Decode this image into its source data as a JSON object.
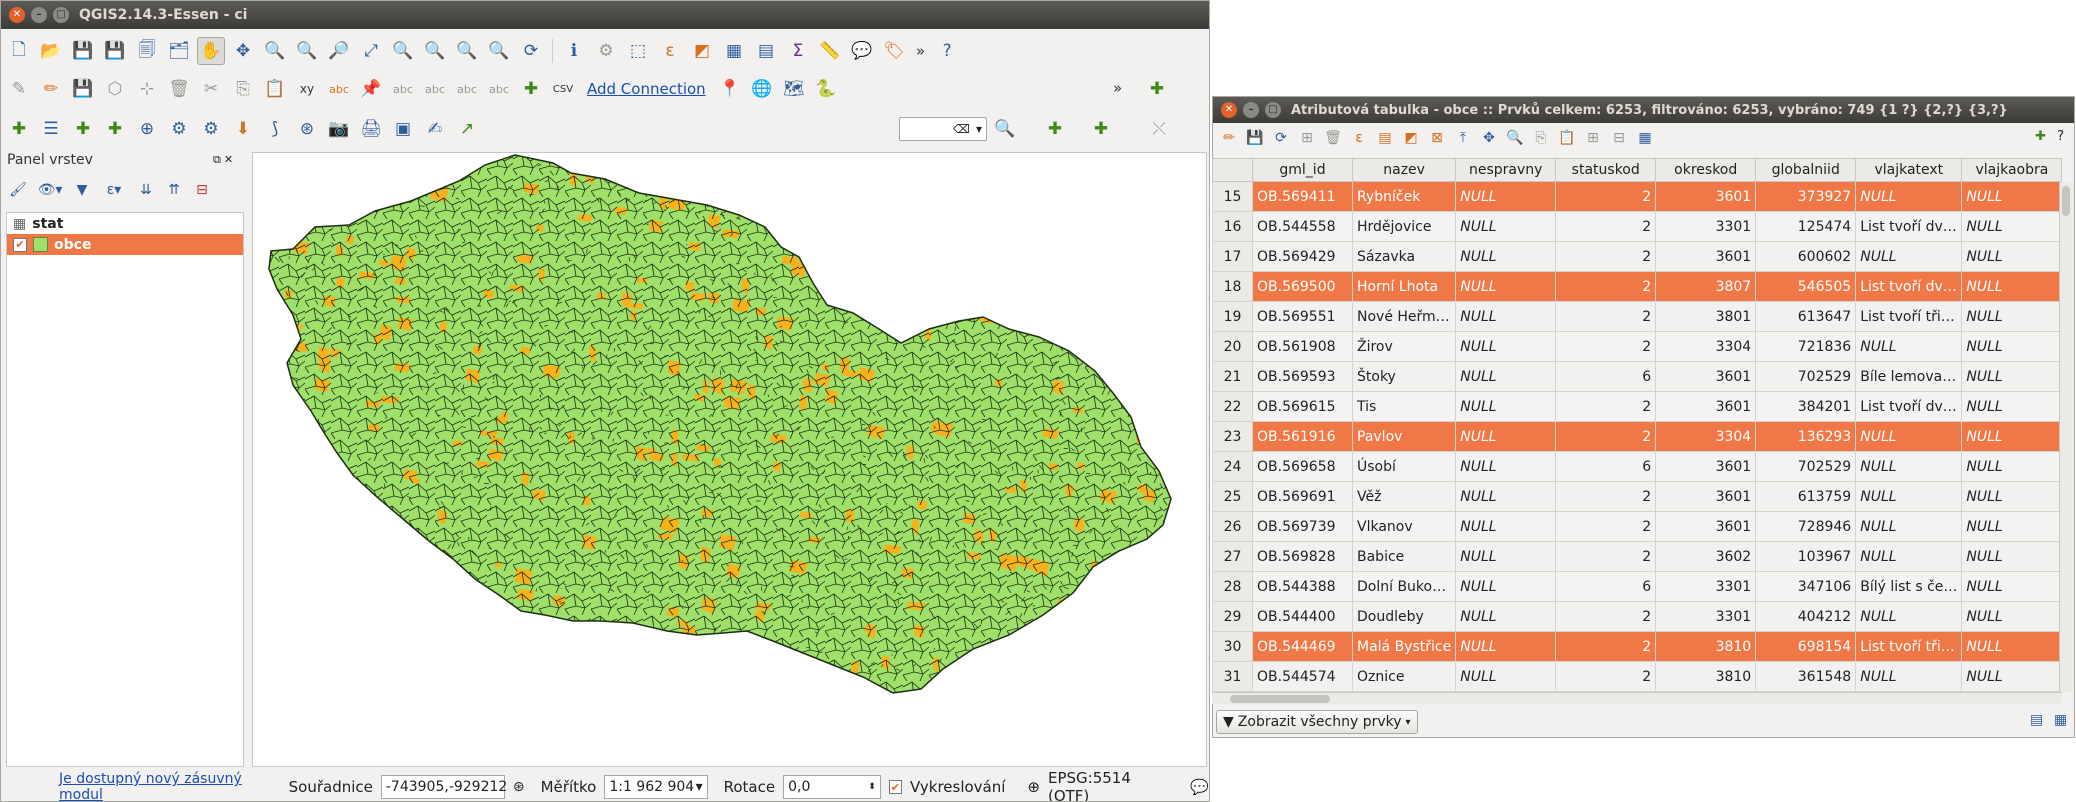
{
  "qgis": {
    "title": "QGIS2.14.3-Essen - ci",
    "add_connection": "Add Connection",
    "panel_title": "Panel vrstev",
    "layers": [
      {
        "name": "stat",
        "type": "table",
        "selected": false
      },
      {
        "name": "obce",
        "type": "polygon",
        "selected": true,
        "checked": true
      }
    ],
    "map": {
      "fill_color": "#9ee06a",
      "selected_color": "#f7b21b",
      "outline_color": "#1d2e12"
    },
    "status": {
      "plugin_link": "Je dostupný nový zásuvný modul",
      "coords_label": "Souřadnice",
      "coords_value": "-743905,-929212",
      "scale_label": "Měřítko",
      "scale_value": "1:1 962 904",
      "rotation_label": "Rotace",
      "rotation_value": "0,0",
      "render_label": "Vykreslování",
      "crs": "EPSG:5514 (OTF)"
    },
    "toolbar1_icons": [
      "new-project-icon",
      "open-icon",
      "save-icon",
      "save-as-icon",
      "new-print-composer-icon",
      "composer-manager-icon",
      "pan-icon",
      "pan-to-selection-icon",
      "zoom-in-icon",
      "zoom-out-icon",
      "zoom-native-icon",
      "zoom-full-icon",
      "zoom-to-selection-icon",
      "zoom-to-layer-icon",
      "zoom-last-icon",
      "zoom-next-icon",
      "refresh-icon",
      "identify-icon",
      "run-action-icon",
      "select-feature-icon",
      "select-by-expression-icon",
      "deselect-icon",
      "attribute-table-icon",
      "field-calculator-icon",
      "statistics-icon",
      "measure-icon",
      "annotation-icon",
      "label-icon",
      "help-icon"
    ],
    "toolbar2_icons": [
      "digitize-icon",
      "edit-pencil-icon",
      "save-edits-icon",
      "add-feature-icon",
      "node-tool-icon",
      "delete-selected-icon",
      "cut-icon",
      "copy-icon",
      "paste-icon",
      "xy-icon",
      "label-tool-icon",
      "pin-label-icon",
      "show-label-icon",
      "move-label-icon",
      "rotate-label-icon",
      "change-label-icon",
      "new-vector-icon",
      "csv-icon",
      "pin-icon",
      "globe-icon",
      "map-icon",
      "python-icon"
    ],
    "toolbar3_icons": [
      "add-vector-icon",
      "add-wms-icon",
      "add-raster-icon",
      "add-spatialite-icon",
      "georeferencer-icon",
      "processing-icon",
      "gps-icon",
      "download-icon",
      "topology-icon",
      "tracking-icon",
      "screenshot-icon",
      "print-icon",
      "layout-icon",
      "edit-icon",
      "arrow-icon",
      "search-icon",
      "cross-icon"
    ]
  },
  "attr_table": {
    "title": "Atributová tabulka  - obce :: Prvků celkem: 6253, filtrováno: 6253, vybráno: 749 {1 ?} {2,?} {3,?}",
    "columns": [
      "gml_id",
      "nazev",
      "nespravny",
      "statuskod",
      "okreskod",
      "globalniid",
      "vlajkatext",
      "vlajkaobra"
    ],
    "rows": [
      {
        "rn": "15",
        "gml_id": "OB.569411",
        "nazev": "Rybníček",
        "nespravny": "NULL",
        "statuskod": "2",
        "okreskod": "3601",
        "globalniid": "373927",
        "vlajkatext": "NULL",
        "vlajkaobra": "NULL",
        "selected": true
      },
      {
        "rn": "16",
        "gml_id": "OB.544558",
        "nazev": "Hrdějovice",
        "nespravny": "NULL",
        "statuskod": "2",
        "okreskod": "3301",
        "globalniid": "125474",
        "vlajkatext": "List tvoří dv…",
        "vlajkaobra": "NULL",
        "selected": false
      },
      {
        "rn": "17",
        "gml_id": "OB.569429",
        "nazev": "Sázavka",
        "nespravny": "NULL",
        "statuskod": "2",
        "okreskod": "3601",
        "globalniid": "600602",
        "vlajkatext": "NULL",
        "vlajkaobra": "NULL",
        "selected": false
      },
      {
        "rn": "18",
        "gml_id": "OB.569500",
        "nazev": "Horní Lhota",
        "nespravny": "NULL",
        "statuskod": "2",
        "okreskod": "3807",
        "globalniid": "546505",
        "vlajkatext": "List tvoří dv…",
        "vlajkaobra": "NULL",
        "selected": true
      },
      {
        "rn": "19",
        "gml_id": "OB.569551",
        "nazev": "Nové Heřm…",
        "nespravny": "NULL",
        "statuskod": "2",
        "okreskod": "3801",
        "globalniid": "613647",
        "vlajkatext": "List tvoří tři…",
        "vlajkaobra": "NULL",
        "selected": false
      },
      {
        "rn": "20",
        "gml_id": "OB.561908",
        "nazev": "Žirov",
        "nespravny": "NULL",
        "statuskod": "2",
        "okreskod": "3304",
        "globalniid": "721836",
        "vlajkatext": "NULL",
        "vlajkaobra": "NULL",
        "selected": false
      },
      {
        "rn": "21",
        "gml_id": "OB.569593",
        "nazev": "Štoky",
        "nespravny": "NULL",
        "statuskod": "6",
        "okreskod": "3601",
        "globalniid": "702529",
        "vlajkatext": "Bíle lemova…",
        "vlajkaobra": "NULL",
        "selected": false
      },
      {
        "rn": "22",
        "gml_id": "OB.569615",
        "nazev": "Tis",
        "nespravny": "NULL",
        "statuskod": "2",
        "okreskod": "3601",
        "globalniid": "384201",
        "vlajkatext": "List tvoří dv…",
        "vlajkaobra": "NULL",
        "selected": false
      },
      {
        "rn": "23",
        "gml_id": "OB.561916",
        "nazev": "Pavlov",
        "nespravny": "NULL",
        "statuskod": "2",
        "okreskod": "3304",
        "globalniid": "136293",
        "vlajkatext": "NULL",
        "vlajkaobra": "NULL",
        "selected": true
      },
      {
        "rn": "24",
        "gml_id": "OB.569658",
        "nazev": "Úsobí",
        "nespravny": "NULL",
        "statuskod": "6",
        "okreskod": "3601",
        "globalniid": "702529",
        "vlajkatext": "NULL",
        "vlajkaobra": "NULL",
        "selected": false
      },
      {
        "rn": "25",
        "gml_id": "OB.569691",
        "nazev": "Věž",
        "nespravny": "NULL",
        "statuskod": "2",
        "okreskod": "3601",
        "globalniid": "613759",
        "vlajkatext": "NULL",
        "vlajkaobra": "NULL",
        "selected": false
      },
      {
        "rn": "26",
        "gml_id": "OB.569739",
        "nazev": "Vlkanov",
        "nespravny": "NULL",
        "statuskod": "2",
        "okreskod": "3601",
        "globalniid": "728946",
        "vlajkatext": "NULL",
        "vlajkaobra": "NULL",
        "selected": false
      },
      {
        "rn": "27",
        "gml_id": "OB.569828",
        "nazev": "Babice",
        "nespravny": "NULL",
        "statuskod": "2",
        "okreskod": "3602",
        "globalniid": "103967",
        "vlajkatext": "NULL",
        "vlajkaobra": "NULL",
        "selected": false
      },
      {
        "rn": "28",
        "gml_id": "OB.544388",
        "nazev": "Dolní Buko…",
        "nespravny": "NULL",
        "statuskod": "6",
        "okreskod": "3301",
        "globalniid": "347106",
        "vlajkatext": "Bílý list s če…",
        "vlajkaobra": "NULL",
        "selected": false
      },
      {
        "rn": "29",
        "gml_id": "OB.544400",
        "nazev": "Doudleby",
        "nespravny": "NULL",
        "statuskod": "2",
        "okreskod": "3301",
        "globalniid": "404212",
        "vlajkatext": "NULL",
        "vlajkaobra": "NULL",
        "selected": false
      },
      {
        "rn": "30",
        "gml_id": "OB.544469",
        "nazev": "Malá Bystřice",
        "nespravny": "NULL",
        "statuskod": "2",
        "okreskod": "3810",
        "globalniid": "698154",
        "vlajkatext": "List tvoří tři…",
        "vlajkaobra": "NULL",
        "selected": true
      },
      {
        "rn": "31",
        "gml_id": "OB.544574",
        "nazev": "Oznice",
        "nespravny": "NULL",
        "statuskod": "2",
        "okreskod": "3810",
        "globalniid": "361548",
        "vlajkatext": "NULL",
        "vlajkaobra": "NULL",
        "selected": false
      }
    ],
    "filter_button": "Zobrazit všechny prvky",
    "toolbar_icons": [
      "toggle-edit-icon",
      "save-icon",
      "reload-icon",
      "add-feature-icon",
      "delete-icon",
      "select-expression-icon",
      "select-all-icon",
      "invert-selection-icon",
      "remove-selection-icon",
      "move-top-icon",
      "pan-map-icon",
      "zoom-map-icon",
      "copy-icon",
      "paste-icon",
      "new-field-icon",
      "delete-field-icon",
      "field-calculator-icon"
    ]
  }
}
